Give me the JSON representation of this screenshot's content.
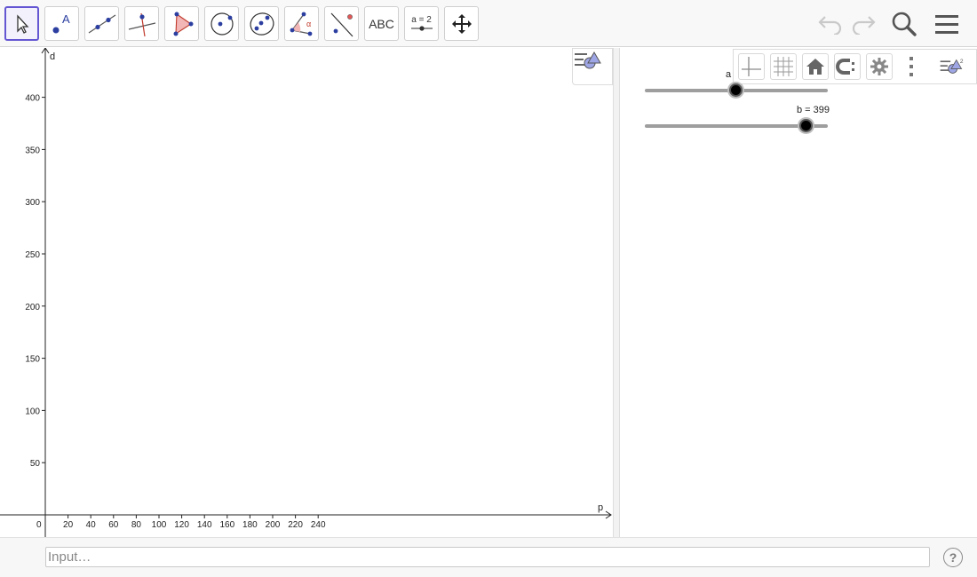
{
  "toolbar": {
    "tools": [
      {
        "name": "move-tool",
        "icon": "arrow-pointer-icon"
      },
      {
        "name": "point-tool",
        "icon": "point-icon",
        "label": "A"
      },
      {
        "name": "line-tool",
        "icon": "line-through-points-icon"
      },
      {
        "name": "perpendicular-line-tool",
        "icon": "perpendicular-line-icon"
      },
      {
        "name": "polygon-tool",
        "icon": "polygon-icon"
      },
      {
        "name": "circle-tool",
        "icon": "circle-center-point-icon"
      },
      {
        "name": "conic-tool",
        "icon": "ellipse-icon"
      },
      {
        "name": "angle-tool",
        "icon": "angle-icon",
        "label": "α"
      },
      {
        "name": "reflect-tool",
        "icon": "reflect-about-line-icon"
      },
      {
        "name": "text-tool",
        "icon": "text-icon",
        "label": "ABC"
      },
      {
        "name": "slider-tool",
        "icon": "slider-icon",
        "label": "a = 2"
      },
      {
        "name": "move-graphics-tool",
        "icon": "move-arrows-icon"
      }
    ],
    "undo_icon": "undo-icon",
    "redo_icon": "redo-icon",
    "search_icon": "search-icon",
    "menu_icon": "hamburger-menu-icon"
  },
  "graphics": {
    "x_axis_label": "p",
    "y_axis_label": "d",
    "origin_label": "0",
    "x_ticks": [
      "20",
      "40",
      "60",
      "80",
      "100",
      "120",
      "140",
      "160",
      "180",
      "200",
      "220",
      "240"
    ],
    "y_ticks": [
      "50",
      "100",
      "150",
      "200",
      "250",
      "300",
      "350",
      "400"
    ],
    "style_toggle_icon": "style-bar-toggle-icon"
  },
  "panel2": {
    "stylebar_buttons": [
      {
        "name": "show-axes-button",
        "icon": "axes-icon"
      },
      {
        "name": "show-grid-button",
        "icon": "grid-icon"
      },
      {
        "name": "home-button",
        "icon": "home-icon"
      },
      {
        "name": "point-capturing-button",
        "icon": "point-capturing-icon"
      },
      {
        "name": "settings-button",
        "icon": "gear-icon"
      },
      {
        "name": "more-options-button",
        "icon": "vertical-dots-icon"
      },
      {
        "name": "style-bar-toggle-2",
        "icon": "style-bar-toggle-icon",
        "label": "2"
      }
    ],
    "sliders": [
      {
        "label": "a",
        "value_fraction": 0.5
      },
      {
        "label": "b = 399",
        "value_fraction": 0.88
      }
    ]
  },
  "inputbar": {
    "placeholder": "Input…",
    "help_label": "?"
  }
}
